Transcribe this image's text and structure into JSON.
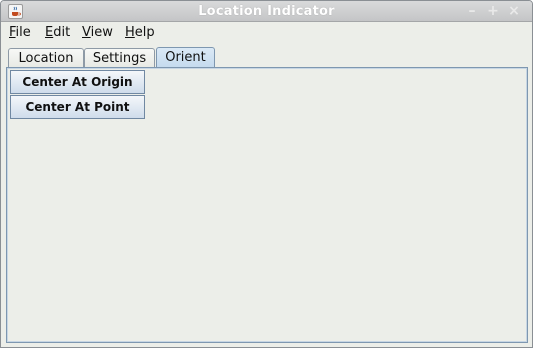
{
  "window": {
    "title": "Location Indicator",
    "app_icon": "java-cup-icon",
    "controls": {
      "minimize": "–",
      "maximize": "+",
      "close": "×"
    }
  },
  "menubar": {
    "items": [
      {
        "mnemonic": "F",
        "rest": "ile"
      },
      {
        "mnemonic": "E",
        "rest": "dit"
      },
      {
        "mnemonic": "V",
        "rest": "iew"
      },
      {
        "mnemonic": "H",
        "rest": "elp"
      }
    ]
  },
  "tabs": {
    "items": [
      "Location",
      "Settings",
      "Orient"
    ],
    "selected": "Orient"
  },
  "orient_panel": {
    "center_origin_label": "Center At Origin",
    "center_point_label": "Center At Point"
  },
  "colors": {
    "selected_tab": "#c4daee",
    "button_gradient_bottom": "#cfdceb",
    "panel_background": "#eceee9"
  }
}
